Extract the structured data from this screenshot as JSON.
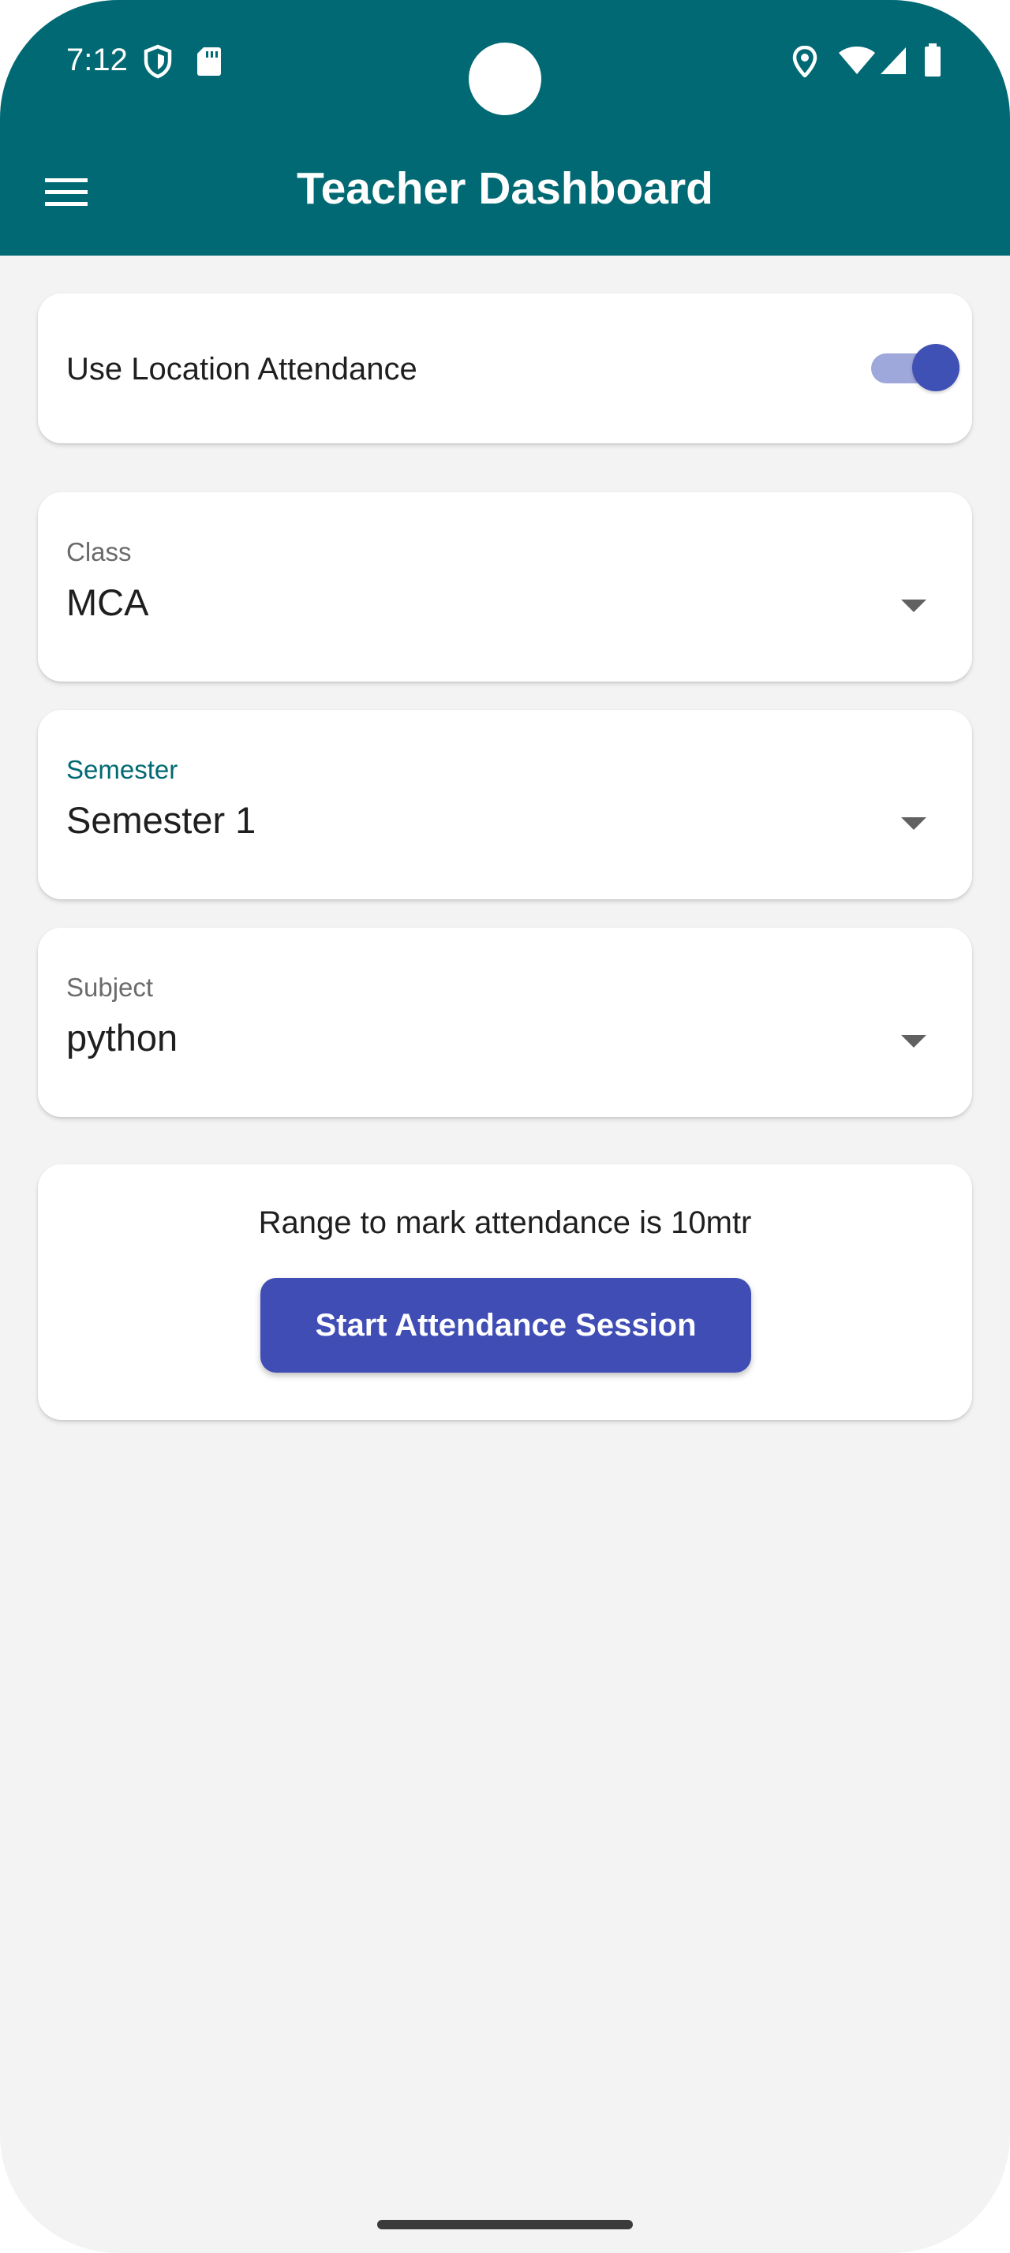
{
  "status_bar": {
    "time": "7:12",
    "icons": [
      "shield-icon",
      "sd-card-icon",
      "location-icon",
      "wifi-icon",
      "signal-icon",
      "battery-icon"
    ]
  },
  "app_bar": {
    "title": "Teacher Dashboard",
    "background_color": "#016973",
    "menu_icon": "hamburger-menu-icon"
  },
  "location_toggle": {
    "label": "Use Location Attendance",
    "enabled": true
  },
  "dropdowns": {
    "class": {
      "label": "Class",
      "value": "MCA"
    },
    "semester": {
      "label": "Semester",
      "value": "Semester 1",
      "focused": true
    },
    "subject": {
      "label": "Subject",
      "value": "python"
    }
  },
  "session": {
    "range_text": "Range to mark attendance is 10mtr",
    "start_button_label": "Start Attendance Session",
    "button_color": "#3f4db5"
  },
  "colors": {
    "accent": "#016973",
    "primary": "#3f51b5",
    "background": "#f3f3f3"
  }
}
